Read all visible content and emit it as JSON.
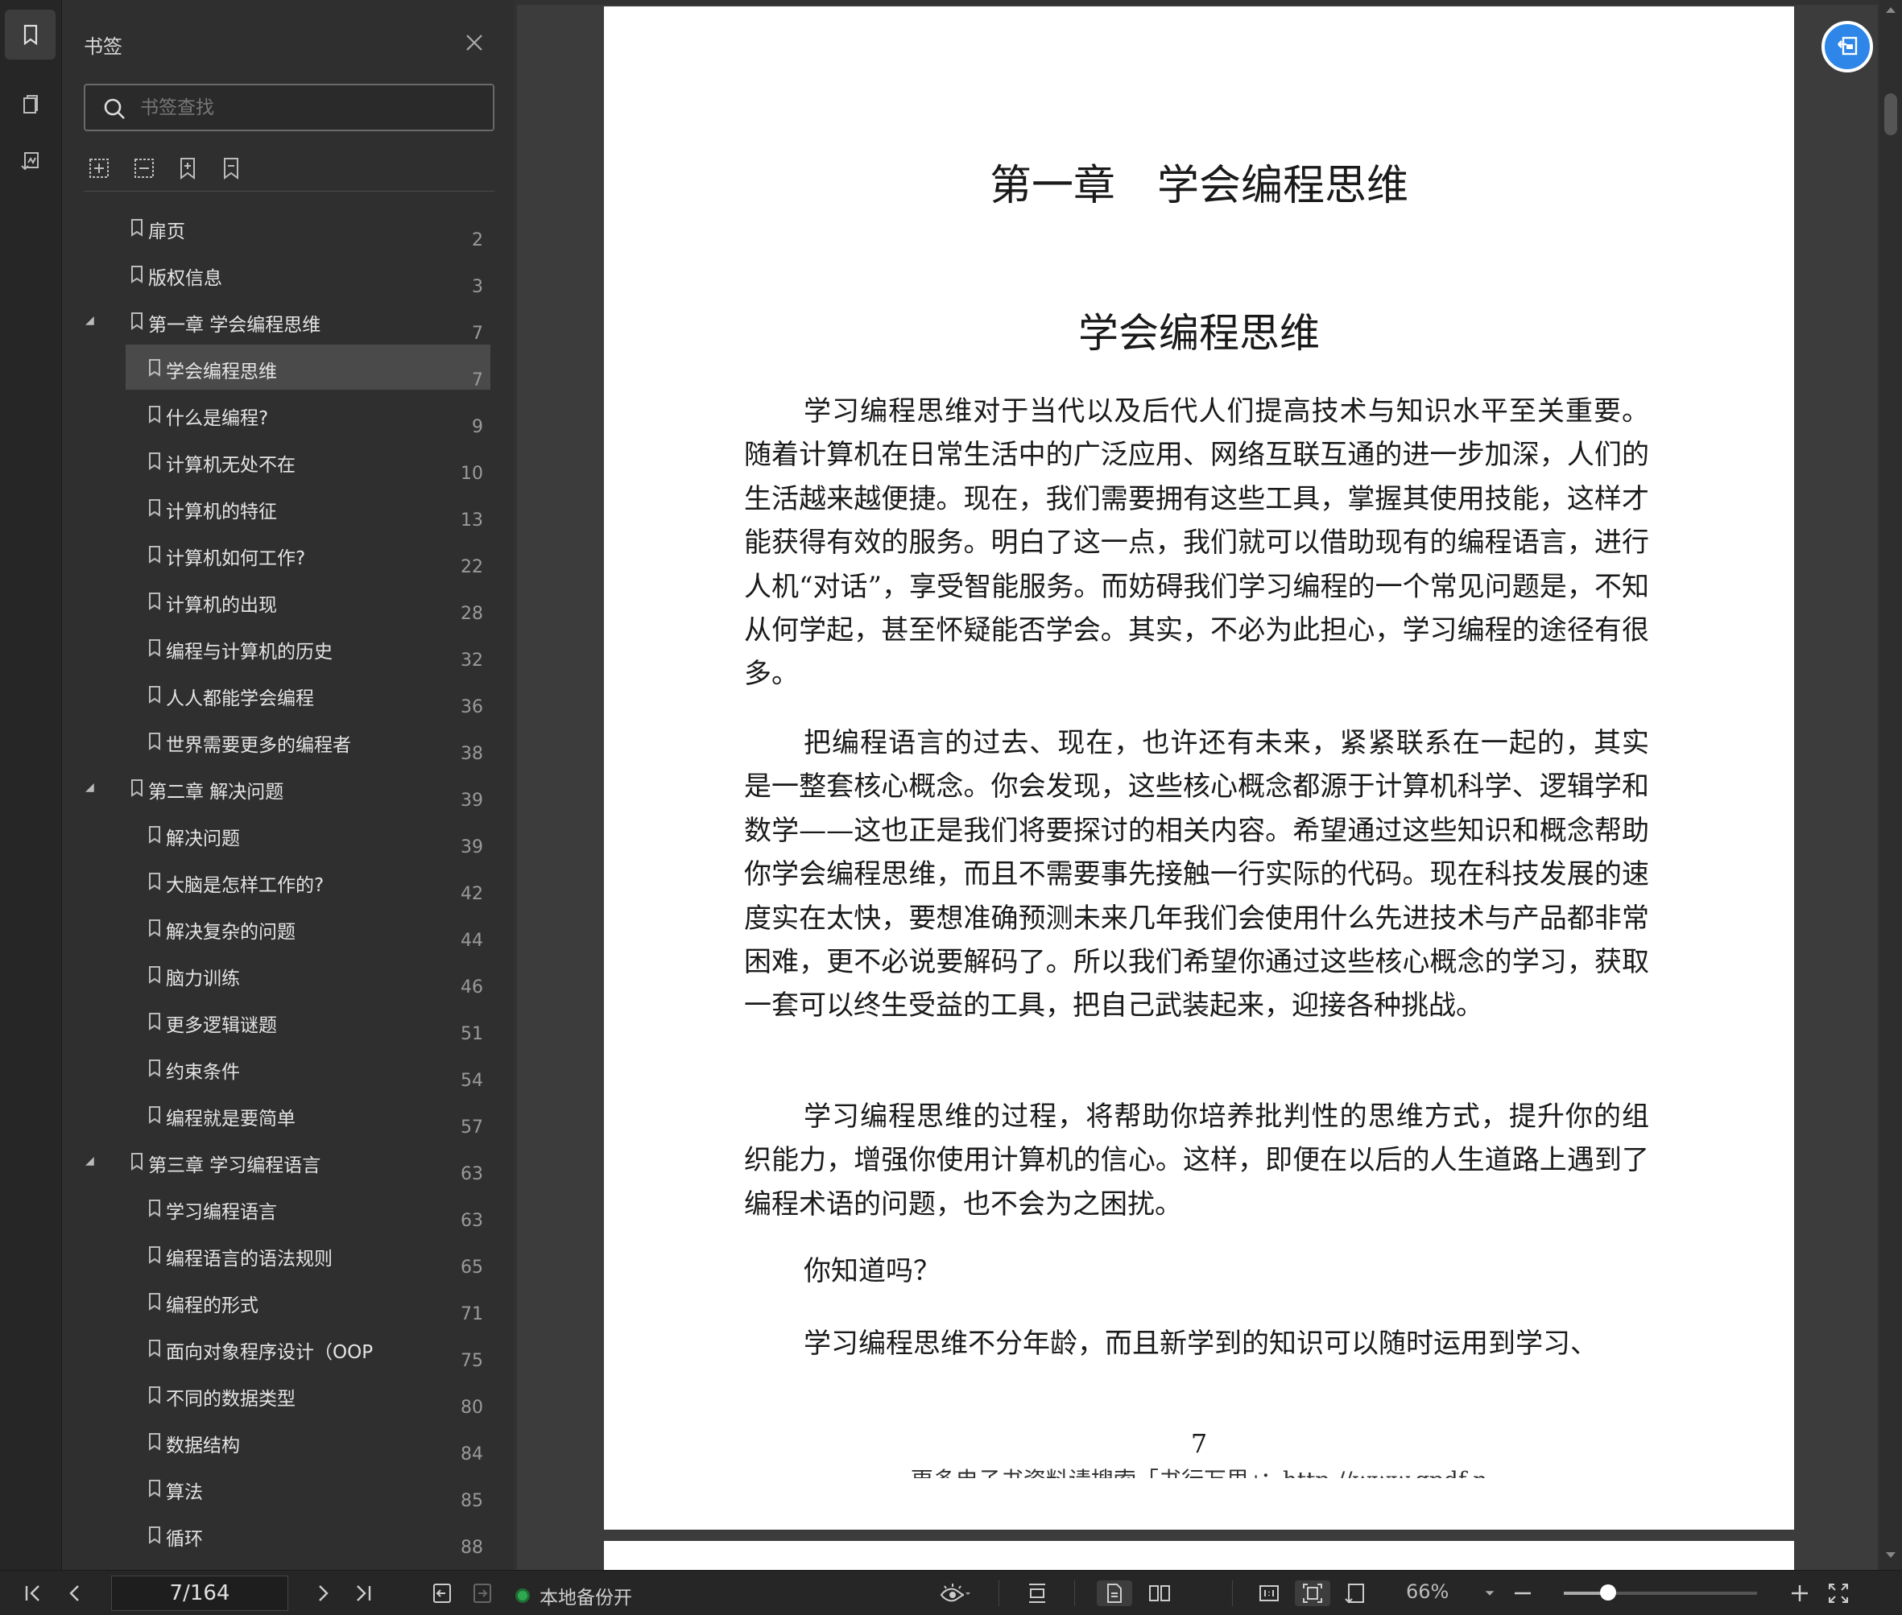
{
  "sidebar": {
    "title": "书签",
    "search_placeholder": "书签查找",
    "items": [
      {
        "label": "扉页",
        "page": "2",
        "level": 0,
        "expandable": false,
        "selected": false
      },
      {
        "label": "版权信息",
        "page": "3",
        "level": 0,
        "expandable": false,
        "selected": false
      },
      {
        "label": "第一章 学会编程思维",
        "page": "7",
        "level": 0,
        "expandable": true,
        "selected": false
      },
      {
        "label": "学会编程思维",
        "page": "7",
        "level": 1,
        "expandable": false,
        "selected": true
      },
      {
        "label": "什么是编程?",
        "page": "9",
        "level": 1,
        "expandable": false,
        "selected": false
      },
      {
        "label": "计算机无处不在",
        "page": "10",
        "level": 1,
        "expandable": false,
        "selected": false
      },
      {
        "label": "计算机的特征",
        "page": "13",
        "level": 1,
        "expandable": false,
        "selected": false
      },
      {
        "label": "计算机如何工作?",
        "page": "22",
        "level": 1,
        "expandable": false,
        "selected": false
      },
      {
        "label": "计算机的出现",
        "page": "28",
        "level": 1,
        "expandable": false,
        "selected": false
      },
      {
        "label": "编程与计算机的历史",
        "page": "32",
        "level": 1,
        "expandable": false,
        "selected": false
      },
      {
        "label": "人人都能学会编程",
        "page": "36",
        "level": 1,
        "expandable": false,
        "selected": false
      },
      {
        "label": "世界需要更多的编程者",
        "page": "38",
        "level": 1,
        "expandable": false,
        "selected": false
      },
      {
        "label": "第二章 解决问题",
        "page": "39",
        "level": 0,
        "expandable": true,
        "selected": false
      },
      {
        "label": "解决问题",
        "page": "39",
        "level": 1,
        "expandable": false,
        "selected": false
      },
      {
        "label": "大脑是怎样工作的?",
        "page": "42",
        "level": 1,
        "expandable": false,
        "selected": false
      },
      {
        "label": "解决复杂的问题",
        "page": "44",
        "level": 1,
        "expandable": false,
        "selected": false
      },
      {
        "label": "脑力训练",
        "page": "46",
        "level": 1,
        "expandable": false,
        "selected": false
      },
      {
        "label": "更多逻辑谜题",
        "page": "51",
        "level": 1,
        "expandable": false,
        "selected": false
      },
      {
        "label": "约束条件",
        "page": "54",
        "level": 1,
        "expandable": false,
        "selected": false
      },
      {
        "label": "编程就是要简单",
        "page": "57",
        "level": 1,
        "expandable": false,
        "selected": false
      },
      {
        "label": "第三章 学习编程语言",
        "page": "63",
        "level": 0,
        "expandable": true,
        "selected": false
      },
      {
        "label": "学习编程语言",
        "page": "63",
        "level": 1,
        "expandable": false,
        "selected": false
      },
      {
        "label": "编程语言的语法规则",
        "page": "65",
        "level": 1,
        "expandable": false,
        "selected": false
      },
      {
        "label": "编程的形式",
        "page": "71",
        "level": 1,
        "expandable": false,
        "selected": false
      },
      {
        "label": "面向对象程序设计（OOP",
        "page": "75",
        "level": 1,
        "expandable": false,
        "selected": false
      },
      {
        "label": "不同的数据类型",
        "page": "80",
        "level": 1,
        "expandable": false,
        "selected": false
      },
      {
        "label": "数据结构",
        "page": "84",
        "level": 1,
        "expandable": false,
        "selected": false
      },
      {
        "label": "算法",
        "page": "85",
        "level": 1,
        "expandable": false,
        "selected": false
      },
      {
        "label": "循环",
        "page": "88",
        "level": 1,
        "expandable": false,
        "selected": false
      }
    ]
  },
  "document": {
    "chapter_title": "第一章　学会编程思维",
    "section_title": "学会编程思维",
    "paragraphs": [
      "学习编程思维对于当代以及后代人们提高技术与知识水平至关重要。随着计算机在日常生活中的广泛应用、网络互联互通的进一步加深，人们的生活越来越便捷。现在，我们需要拥有这些工具，掌握其使用技能，这样才能获得有效的服务。明白了这一点，我们就可以借助现有的编程语言，进行人机“对话”，享受智能服务。而妨碍我们学习编程的一个常见问题是，不知从何学起，甚至怀疑能否学会。其实，不必为此担心，学习编程的途径有很多。",
      "把编程语言的过去、现在，也许还有未来，紧紧联系在一起的，其实是一整套核心概念。你会发现，这些核心概念都源于计算机科学、逻辑学和数学——这也正是我们将要探讨的相关内容。希望通过这些知识和概念帮助你学会编程思维，而且不需要事先接触一行实际的代码。现在科技发展的速度实在太快，要想准确预测未来几年我们会使用什么先进技术与产品都非常困难，更不必说要解码了。所以我们希望你通过这些核心概念的学习，获取一套可以终生受益的工具，把自己武装起来，迎接各种挑战。",
      "学习编程思维的过程，将帮助你培养批判性的思维方式，提升你的组织能力，增强你使用计算机的信心。这样，即便在以后的人生道路上遇到了编程术语的问题，也不会为之困扰。",
      "你知道吗？",
      "学习编程思维不分年龄，而且新学到的知识可以随时运用到学习、"
    ],
    "page_number": "7",
    "footer": "更多电子书资料请搜索「书行万里」：http://www.gpdf.n"
  },
  "statusbar": {
    "page_indicator": "7/164",
    "backup_label": "本地备份开",
    "zoom_label": "66%",
    "zoom_fraction": 0.23
  },
  "colors": {
    "accent": "#2d86e8",
    "backup_dot": "#2fa84f"
  }
}
